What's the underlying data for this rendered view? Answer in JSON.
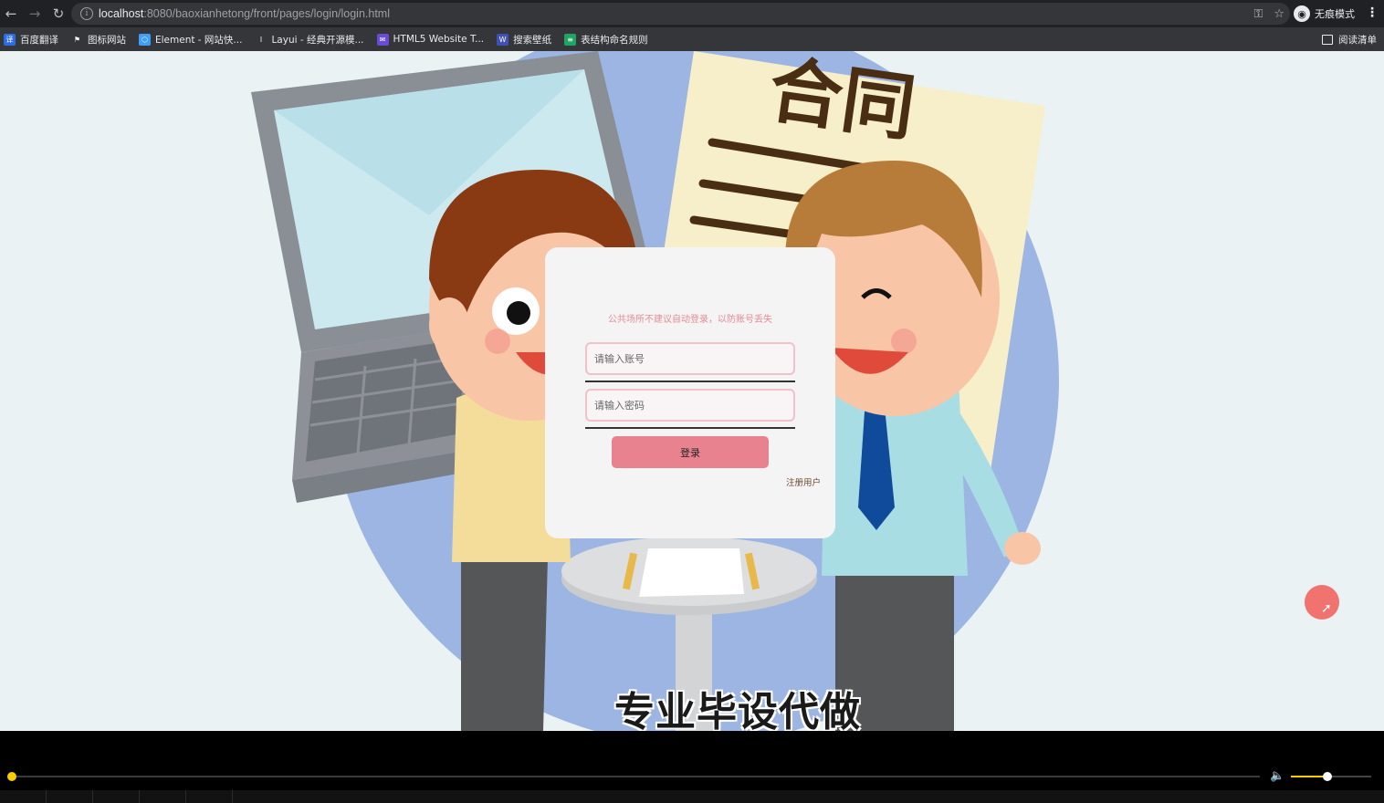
{
  "browser": {
    "url_host": "localhost",
    "url_rest": ":8080/baoxianhetong/front/pages/login/login.html",
    "incognito_label": "无痕模式",
    "reading_list_label": "阅读清单"
  },
  "bookmarks": [
    {
      "label": "百度翻译",
      "icon": "translate-icon",
      "color": "#2b6de5",
      "glyph": "译"
    },
    {
      "label": "图标网站",
      "icon": "flag-icon",
      "color": "#35363a",
      "glyph": "⚑"
    },
    {
      "label": "Element - 网站快...",
      "icon": "element-icon",
      "color": "#409eff",
      "glyph": "⬡"
    },
    {
      "label": "Layui - 经典开源模...",
      "icon": "layui-icon",
      "color": "#35363a",
      "glyph": "l"
    },
    {
      "label": "HTML5 Website T...",
      "icon": "html5-icon",
      "color": "#6a4bd8",
      "glyph": "✉"
    },
    {
      "label": "搜索壁纸",
      "icon": "wallpaper-icon",
      "color": "#3f51b5",
      "glyph": "W"
    },
    {
      "label": "表结构命名规则",
      "icon": "table-icon",
      "color": "#1fa463",
      "glyph": "≡"
    }
  ],
  "login": {
    "notice": "公共场所不建议自动登录，以防账号丢失",
    "account_placeholder": "请输入账号",
    "password_placeholder": "请输入密码",
    "login_button": "登录",
    "register_link": "注册用户"
  },
  "illustration": {
    "contract_text": "合同"
  },
  "caption": "专业毕设代做",
  "player": {
    "progress": 0.0,
    "volume": 0.45
  },
  "colors": {
    "accent": "#e8828f",
    "notice": "#e58b95",
    "page_bg": "#eaf2f4"
  }
}
